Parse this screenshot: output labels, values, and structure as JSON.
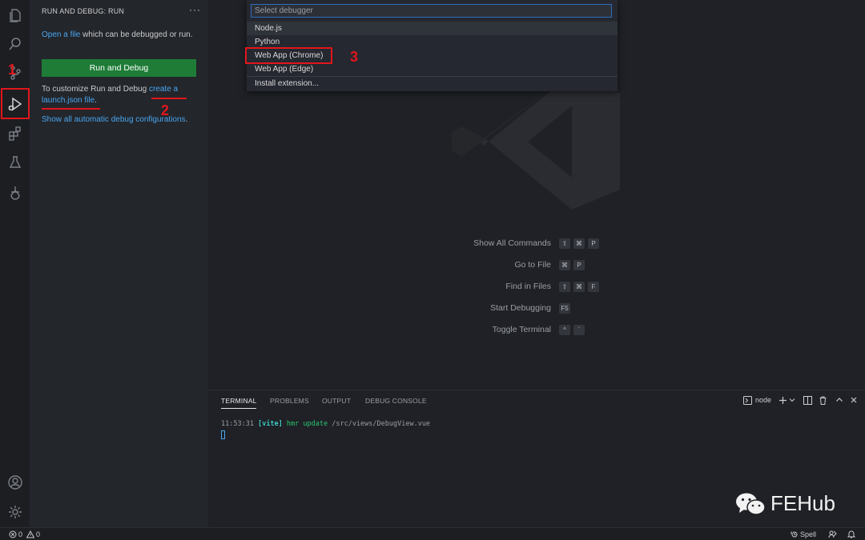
{
  "sidebar": {
    "title": "RUN AND DEBUG: RUN",
    "more": "···",
    "open_link": "Open a file",
    "open_rest": " which can be debugged or run.",
    "run_button": "Run and Debug",
    "customize_prefix": "To customize Run and Debug ",
    "create_link": "create a launch.json file",
    "customize_suffix": ".",
    "show_all_link": "Show all automatic debug configurations",
    "show_all_suffix": "."
  },
  "quickpick": {
    "placeholder": "Select debugger",
    "items": [
      "Node.js",
      "Python",
      "Web App (Chrome)",
      "Web App (Edge)",
      "Install extension..."
    ]
  },
  "hints": [
    {
      "label": "Show All Commands",
      "keys": [
        "⇧",
        "⌘",
        "P"
      ]
    },
    {
      "label": "Go to File",
      "keys": [
        "⌘",
        "P"
      ]
    },
    {
      "label": "Find in Files",
      "keys": [
        "⇧",
        "⌘",
        "F"
      ]
    },
    {
      "label": "Start Debugging",
      "keys": [
        "F5"
      ]
    },
    {
      "label": "Toggle Terminal",
      "keys": [
        "^",
        "`"
      ]
    }
  ],
  "panel": {
    "tabs": [
      "TERMINAL",
      "PROBLEMS",
      "OUTPUT",
      "DEBUG CONSOLE"
    ],
    "active_tab": "TERMINAL",
    "terminal_name": "node",
    "terminal": {
      "time": "11:53:31",
      "tag": "[vite]",
      "msg": "hmr update",
      "path": "/src/views/DebugView.vue"
    }
  },
  "annotations": {
    "one": "1",
    "two": "2",
    "three": "3"
  },
  "statusbar": {
    "errors": "0",
    "warnings": "0",
    "spell": "Spell"
  },
  "brand": {
    "text": "FEHub"
  },
  "colors": {
    "accent_link": "#4aa6f0",
    "run_button": "#1e7c36",
    "annotation": "#e0161c",
    "vite_tag": "#3ec7c2",
    "terminal_msg": "#28c76f"
  },
  "icons": [
    "files-icon",
    "search-icon",
    "source-control-icon",
    "run-debug-icon",
    "extensions-icon",
    "testing-icon",
    "remote-icon",
    "account-icon",
    "gear-icon"
  ]
}
